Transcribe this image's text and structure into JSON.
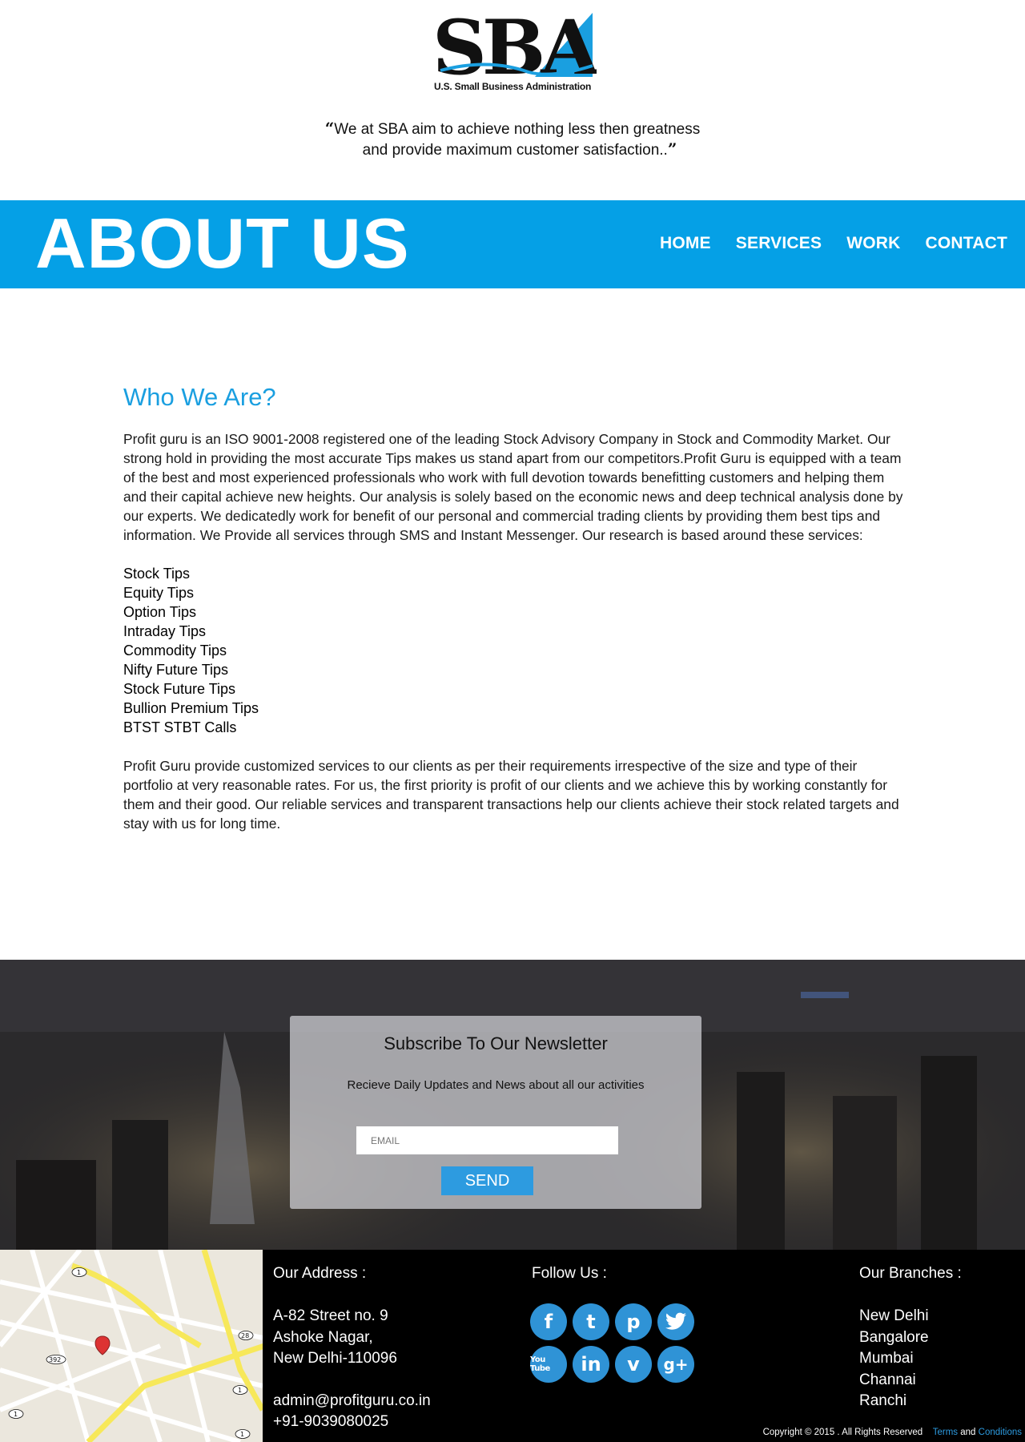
{
  "header": {
    "logo_text": "SBA",
    "logo_subtitle": "U.S. Small Business Administration",
    "quote_open": "“",
    "quote_line1": "We at SBA aim to achieve nothing less then greatness",
    "quote_line2": "and provide maximum customer satisfaction..",
    "quote_close": "”"
  },
  "band": {
    "title": "ABOUT US",
    "nav": [
      "HOME",
      "SERVICES",
      "WORK",
      "CONTACT"
    ]
  },
  "main": {
    "heading": "Who We Are?",
    "intro": "Profit guru is an ISO 9001-2008 registered one of the leading Stock Advisory Company in Stock and Commodity Market. Our strong hold in providing the most accurate Tips makes us stand apart from our competitors.Profit Guru is equipped with a team of the best and most experienced professionals who work with full devotion towards benefitting customers and helping them and their capital achieve new heights. Our analysis is solely based on the economic news and deep technical analysis done by our experts. We dedicatedly work for benefit of our personal and commercial trading clients by providing them best tips and information. We Provide all services through SMS and Instant Messenger. Our research is based around these services:",
    "services": [
      "Stock Tips",
      "Equity Tips",
      "Option Tips",
      "Intraday Tips",
      "Commodity Tips",
      "Nifty Future Tips",
      "Stock Future Tips",
      "Bullion Premium Tips",
      "BTST STBT Calls"
    ],
    "outro": "Profit Guru provide customized services to our clients as per their requirements irrespective of the size and type of their portfolio at very reasonable rates. For us, the first priority is profit of our clients and we achieve this by working constantly for them and their good. Our reliable services and transparent transactions help our clients achieve their stock related targets and stay with us for long time."
  },
  "newsletter": {
    "title": "Subscribe To Our Newsletter",
    "subtitle": "Recieve Daily Updates and News about all our activities",
    "email_placeholder": "EMAIL",
    "send_label": "SEND"
  },
  "footer": {
    "address_title": "Our Address :",
    "address_lines": [
      "A-82 Street no. 9",
      "Ashoke Nagar,",
      "New Delhi-110096"
    ],
    "email": "admin@profitguru.co.in",
    "phone": "+91-9039080025",
    "follow_title": "Follow Us :",
    "social": [
      {
        "name": "facebook-icon",
        "glyph": "f"
      },
      {
        "name": "tumblr-icon",
        "glyph": "t"
      },
      {
        "name": "pinterest-icon",
        "glyph": "p"
      },
      {
        "name": "twitter-icon",
        "glyph": "🐦"
      },
      {
        "name": "youtube-icon",
        "glyph": "You Tube"
      },
      {
        "name": "linkedin-icon",
        "glyph": "in"
      },
      {
        "name": "vimeo-icon",
        "glyph": "v"
      },
      {
        "name": "google-plus-icon",
        "glyph": "g+"
      }
    ],
    "branches_title": "Our Branches :",
    "branches": [
      "New Delhi",
      "Bangalore",
      "Mumbai",
      "Channai",
      "Ranchi"
    ],
    "copyright": "Copyright © 2015 . All Rights Reserved",
    "terms_label": "Terms",
    "and_label": "and",
    "conditions_label": "Conditions",
    "map_labels": [
      "1",
      "28",
      "392",
      "1",
      "1",
      "1"
    ]
  },
  "colors": {
    "brand_blue": "#05a0e6",
    "heading_blue": "#1a9fe0",
    "button_blue": "#2d9be0",
    "footer_bg": "#000000"
  }
}
